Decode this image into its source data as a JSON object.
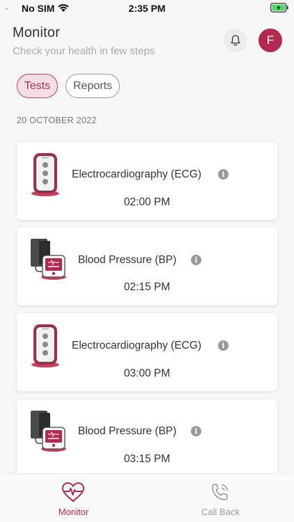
{
  "status_bar": {
    "carrier": "No SIM",
    "time": "2:35 PM",
    "battery_color": "#4cd964"
  },
  "header": {
    "title": "Monitor",
    "subtitle": "Check your health in few steps",
    "avatar_initial": "F",
    "avatar_color": "#b3294f"
  },
  "tabs": [
    {
      "label": "Tests",
      "active": true
    },
    {
      "label": "Reports",
      "active": false
    }
  ],
  "date_heading": "20 OCTOBER 2022",
  "tests": [
    {
      "name": "Electrocardiography (ECG)",
      "time": "02:00 PM",
      "device_icon": "ecg-device-icon"
    },
    {
      "name": "Blood Pressure (BP)",
      "time": "02:15 PM",
      "device_icon": "bp-monitor-icon"
    },
    {
      "name": "Electrocardiography (ECG)",
      "time": "03:00 PM",
      "device_icon": "ecg-device-icon"
    },
    {
      "name": "Blood Pressure (BP)",
      "time": "03:15 PM",
      "device_icon": "bp-monitor-icon"
    }
  ],
  "bottom_nav": [
    {
      "label": "Monitor",
      "icon": "heartbeat-icon",
      "active": true
    },
    {
      "label": "Call Back",
      "icon": "phone-call-icon",
      "active": false
    }
  ],
  "accent_color": "#b3294f"
}
